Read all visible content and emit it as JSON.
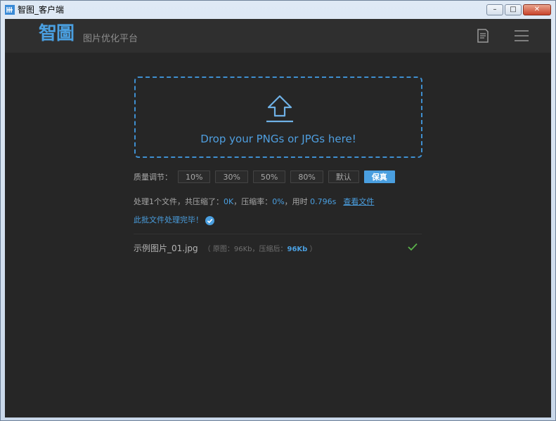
{
  "window": {
    "title": "智图_客户端",
    "controls": {
      "minimize": "–",
      "maximize": "□",
      "close": "✕"
    }
  },
  "header": {
    "logo": "智圖",
    "subtitle": "图片优化平台",
    "icons": [
      "document-icon",
      "menu-icon"
    ]
  },
  "dropzone": {
    "text": "Drop your PNGs or JPGs here!",
    "icon": "upload-icon"
  },
  "quality": {
    "label": "质量调节：",
    "options": [
      "10%",
      "30%",
      "50%",
      "80%",
      "默认",
      "保真"
    ],
    "selected": "保真"
  },
  "stats": {
    "prefix": "处理1个文件，共压缩了：",
    "compressed": "0K",
    "ratio_label": "，压缩率：",
    "ratio": "0%",
    "time_label": "，用时",
    "time": "0.796s",
    "view_files": "查看文件"
  },
  "status": {
    "done_text": "此批文件处理完毕！"
  },
  "files": [
    {
      "name": "示例图片_01.jpg",
      "meta_open": "（ 原图：",
      "original": "96Kb",
      "meta_mid": "，压缩后：",
      "compressed": "96Kb",
      "meta_close": " ）"
    }
  ],
  "colors": {
    "accent": "#4a9fe0",
    "background": "#262626",
    "header": "#2f2f2f",
    "success": "#5ab34a"
  }
}
